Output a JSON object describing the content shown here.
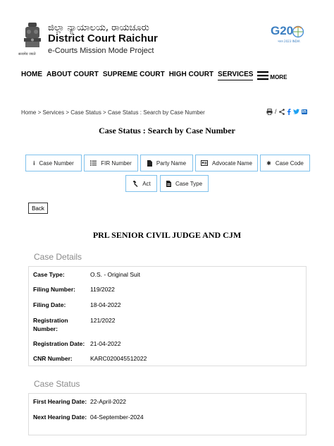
{
  "header": {
    "emblem_caption": "सत्यमेव जयते",
    "kannada_title": "ಜಿಲ್ಲಾ ನ್ಯಾಯಾಲಯ, ರಾಯಚೂರು",
    "title": "District Court Raichur",
    "subtitle": "e-Courts Mission Mode Project",
    "g20_label": "G20",
    "g20_sub": "भारत 2023 INDIA"
  },
  "nav": {
    "items": [
      "HOME",
      "ABOUT COURT",
      "SUPREME COURT",
      "HIGH COURT",
      "SERVICES"
    ],
    "more": "MORE"
  },
  "breadcrumb": {
    "text": "Home > Services > Case Status > Case Status : Search by Case Number"
  },
  "share": {
    "separator": "/"
  },
  "page_title": "Case Status : Search by Case Number",
  "tabs": [
    {
      "label": "Case Number",
      "icon": "info-icon"
    },
    {
      "label": "FIR Number",
      "icon": "list-icon"
    },
    {
      "label": "Party Name",
      "icon": "document-icon"
    },
    {
      "label": "Advocate Name",
      "icon": "id-card-icon"
    },
    {
      "label": "Case Code",
      "icon": "gear-icon"
    },
    {
      "label": "Act",
      "icon": "gavel-icon"
    },
    {
      "label": "Case Type",
      "icon": "file-icon"
    }
  ],
  "back_label": "Back",
  "court_name": "PRL SENIOR CIVIL JUDGE AND CJM",
  "case_details": {
    "title": "Case Details",
    "rows": [
      {
        "label": "Case Type:",
        "value": "O.S. - Original Suit"
      },
      {
        "label": "Filing Number:",
        "value": "119/2022"
      },
      {
        "label": "Filing Date:",
        "value": "18-04-2022"
      },
      {
        "label": "Registration Number:",
        "value": "121/2022"
      },
      {
        "label": "Registration Date:",
        "value": "21-04-2022"
      },
      {
        "label": "CNR Number:",
        "value": "KARC020045512022"
      }
    ]
  },
  "case_status": {
    "title": "Case Status",
    "rows": [
      {
        "label": "First Hearing Date:",
        "value": "22-April-2022"
      },
      {
        "label": "Next Hearing Date:",
        "value": "04-September-2024"
      }
    ]
  },
  "colors": {
    "tab_border": "#7fc1ec",
    "section_title": "#8a8a8a",
    "panel_border": "#dddddd"
  }
}
